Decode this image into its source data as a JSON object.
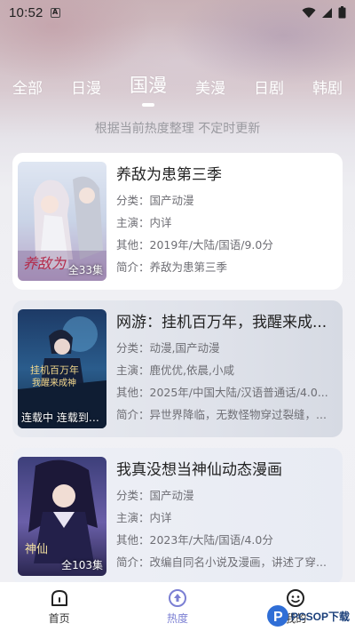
{
  "status_bar": {
    "time": "10:52",
    "notification": "A"
  },
  "tabs": [
    {
      "label": "全部",
      "active": false
    },
    {
      "label": "日漫",
      "active": false
    },
    {
      "label": "国漫",
      "active": true
    },
    {
      "label": "美漫",
      "active": false
    },
    {
      "label": "日剧",
      "active": false
    },
    {
      "label": "韩剧",
      "active": false
    }
  ],
  "subtitle": "根据当前热度整理 不定时更新",
  "cards": [
    {
      "title": "养敌为患第三季",
      "badge": "全33集",
      "category": "分类：国产动漫",
      "cast": "主演：内详",
      "other": "其他：2019年/大陆/国语/9.0分",
      "intro": "简介：养敌为患第三季"
    },
    {
      "title": "网游：挂机百万年，我醒来成...",
      "badge": "连载中 连载到1...",
      "category": "分类：动漫,国产动漫",
      "cast": "主演：鹿优优,依晨,小咸",
      "other": "其他：2025年/中国大陆/汉语普通话/4.0...",
      "intro": "简介：异世界降临，无数怪物穿过裂缝，..."
    },
    {
      "title": "我真没想当神仙动态漫画",
      "badge": "全103集",
      "category": "分类：国产动漫",
      "cast": "主演：内详",
      "other": "其他：2023年/大陆/国语/4.0分",
      "intro": "简介：改编自同名小说及漫画，讲述了穿..."
    }
  ],
  "bottom_nav": [
    {
      "label": "首页",
      "icon": "home-icon",
      "active": false
    },
    {
      "label": "热度",
      "icon": "hot-icon",
      "active": true
    },
    {
      "label": "我的",
      "icon": "user-icon",
      "active": false
    }
  ],
  "watermark": {
    "text": "PCSOP下载",
    "mark": "P"
  },
  "colors": {
    "accent": "#7b7fd3",
    "tab_text": "#ffffff",
    "subtitle": "#9a9aa0"
  }
}
